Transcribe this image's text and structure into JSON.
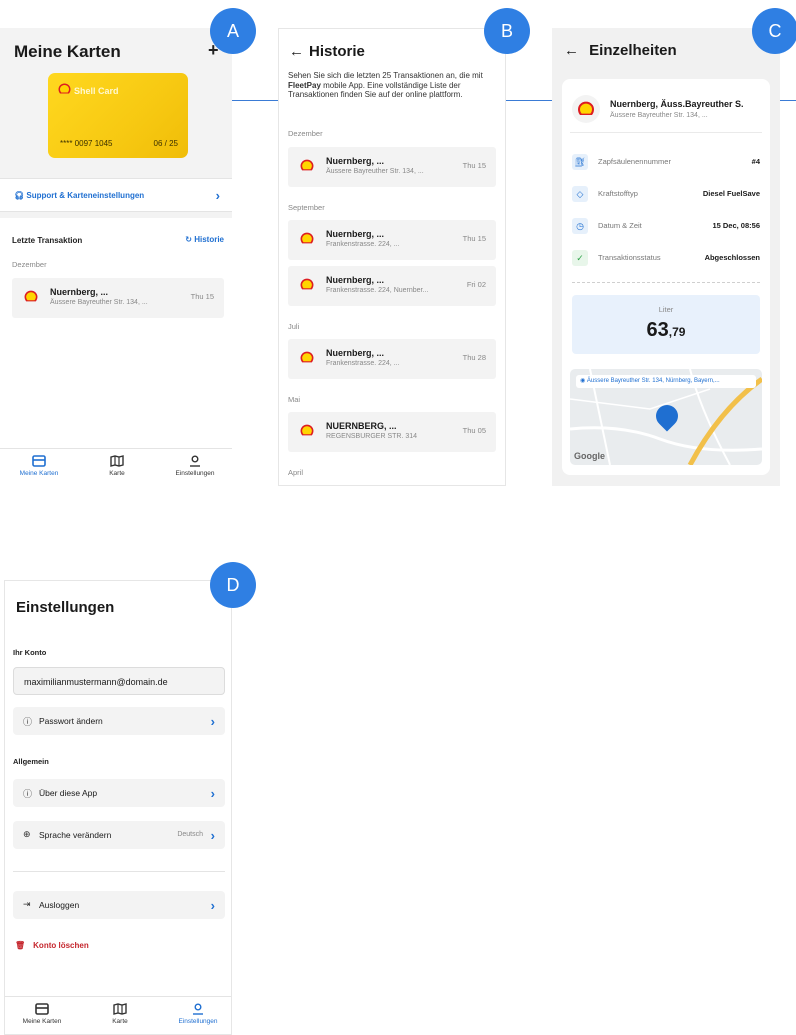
{
  "badges": [
    "A",
    "B",
    "C",
    "D"
  ],
  "screen_a": {
    "title": "Meine Karten",
    "add_icon": "plus-icon",
    "card": {
      "name": "Shell Card",
      "number": "**** 0097 1045",
      "expiry": "06 / 25",
      "color": "#ffd81f"
    },
    "support_label": "Support & Karteneinstellungen",
    "last_transaction_label": "Letzte Transaktion",
    "history_link": "Historie",
    "month": "Dezember",
    "transaction": {
      "name": "Nuernberg, ...",
      "address": "Äussere Bayreuther Str. 134, ...",
      "date": "Thu 15"
    }
  },
  "nav": {
    "items": [
      {
        "label": "Meine Karten",
        "icon": "card-icon"
      },
      {
        "label": "Karte",
        "icon": "map-icon"
      },
      {
        "label": "Einstellungen",
        "icon": "user-icon"
      }
    ]
  },
  "screen_b": {
    "title": "Historie",
    "desc_pre": "Sehen Sie sich die letzten 25 Transaktionen an, die mit ",
    "desc_bold": "FleetPay",
    "desc_post": " mobile App. Eine vollständige Liste der Transaktionen finden Sie auf der online plattform.",
    "months": [
      "Dezember",
      "September",
      "Juli",
      "Mai",
      "April"
    ],
    "transactions": [
      {
        "name": "Nuernberg, ...",
        "address": "Äussere Bayreuther Str. 134, ...",
        "date": "Thu 15"
      },
      {
        "name": "Nuernberg, ...",
        "address": "Frankenstrasse. 224, ...",
        "date": "Thu 15"
      },
      {
        "name": "Nuernberg, ...",
        "address": "Frankenstrasse. 224, Nuernber...",
        "date": "Fri 02"
      },
      {
        "name": "Nuernberg, ...",
        "address": "Frankenstrasse. 224, ...",
        "date": "Thu 28"
      },
      {
        "name": "NUERNBERG, ...",
        "address": "REGENSBURGER STR. 314",
        "date": "Thu 05"
      }
    ]
  },
  "screen_c": {
    "title": "Einzelheiten",
    "station_name": "Nuernberg, Äuss.Bayreuther S.",
    "station_address": "Äussere Bayreuther Str. 134, ...",
    "details": [
      {
        "label": "Zapfsäulenennummer",
        "value": "#4",
        "icon": "pump-icon"
      },
      {
        "label": "Kraftstofftyp",
        "value": "Diesel FuelSave",
        "icon": "drop-icon"
      },
      {
        "label": "Datum & Zeit",
        "value": "15 Dec, 08:56",
        "icon": "clock-icon"
      },
      {
        "label": "Transaktionsstatus",
        "value": "Abgeschlossen",
        "icon": "check-icon"
      }
    ],
    "liter_label": "Liter",
    "liter_int": "63",
    "liter_dec": ",79",
    "map_address": "Äussere Bayreuther Str. 134, Nürnberg, Bayern,...",
    "map_attribution": "Google"
  },
  "screen_d": {
    "title": "Einstellungen",
    "account_section": "Ihr Konto",
    "email": "maximilianmustermann@domain.de",
    "password_label": "Passwort ändern",
    "general_section": "Allgemein",
    "about_label": "Über diese App",
    "language_label": "Sprache verändern",
    "language_value": "Deutsch",
    "logout_label": "Ausloggen",
    "delete_label": "Konto löschen"
  },
  "colors": {
    "accent": "#1f6fd1",
    "badge": "#2f7fe3",
    "danger": "#c5262d",
    "shell_red": "#dd1d21",
    "shell_yellow": "#ffd500"
  }
}
